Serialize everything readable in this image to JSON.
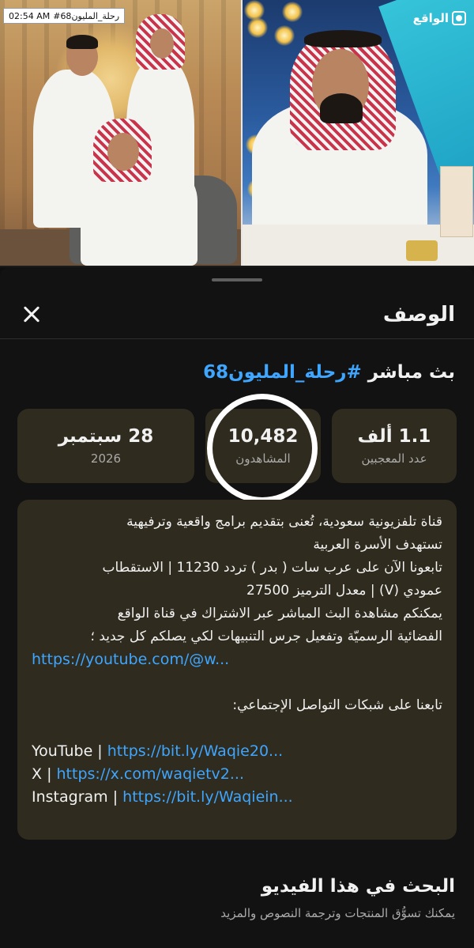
{
  "status": {
    "time": "02:54 AM",
    "title": "#رحلة_المليون68"
  },
  "channel": {
    "brand": "الواقع"
  },
  "sheet": {
    "title": "الوصف",
    "close_label": "Close"
  },
  "video": {
    "prefix": "بث مباشر ",
    "hashtag": "#رحلة_المليون68"
  },
  "stats": {
    "likes": {
      "value": "1.1 ألف",
      "label": "عدد المعجبين"
    },
    "views": {
      "value": "10,482",
      "label": "المشاهدون"
    },
    "date": {
      "value": "28 سبتمبر",
      "label": "2026"
    }
  },
  "description": {
    "lines": [
      "قناة تلفزيونية سعودية، تُعنى بتقديم برامج واقعية وترفيهية",
      "تستهدف الأسرة العربية",
      "تابعونا الآن على عرب سات ( بدر ) تردد 11230 | الاستقطاب",
      "عمودي (V) | معدل الترميز 27500",
      "يمكنكم مشاهدة البث المباشر عبر الاشتراك في قناة الواقع",
      "الفضائية الرسميّة وتفعيل جرس التنبيهات لكي يصلكم كل جديد ؛"
    ],
    "youtube_link": "https://youtube.com/@w...",
    "social_heading": "تابعنا على شبكات التواصل الإجتماعي:",
    "social": [
      {
        "name": "YouTube",
        "sep": " | ",
        "link": "https://bit.ly/Waqie20..."
      },
      {
        "name": "X",
        "sep": " | ",
        "link": "https://x.com/waqietv2..."
      },
      {
        "name": "Instagram",
        "sep": " | ",
        "link": "https://bit.ly/Waqiein..."
      }
    ]
  },
  "search_section": {
    "title": "البحث في هذا الفيديو",
    "subtitle": "يمكنك تسوُّق المنتجات وترجمة النصوص والمزيد"
  },
  "colors": {
    "background": "#121212",
    "card": "#2f2b1e",
    "link": "#3ea6ff",
    "muted": "#aaaaaa"
  },
  "icons": {
    "close": "close-icon",
    "brand": "waqie-logo-icon"
  }
}
